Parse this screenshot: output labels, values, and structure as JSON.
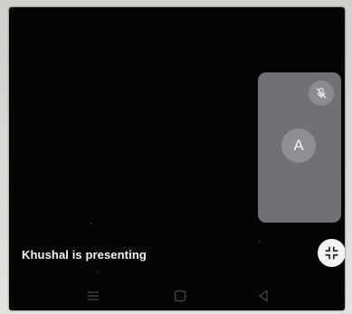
{
  "meeting": {
    "presenting_text": "Khushal is presenting"
  },
  "participant_tile": {
    "avatar_letter": "A",
    "mic_state": "muted",
    "mic_icon": "mic-off-icon"
  },
  "controls": {
    "exit_fullscreen_icon": "exit-fullscreen-icon"
  },
  "nav_bar": {
    "buttons": [
      "menu-icon",
      "home-icon",
      "back-icon"
    ]
  },
  "colors": {
    "screen_background": "#050505",
    "tile_background": "#707175",
    "avatar_background": "#8e8f93",
    "text": "#f4f4f4"
  }
}
